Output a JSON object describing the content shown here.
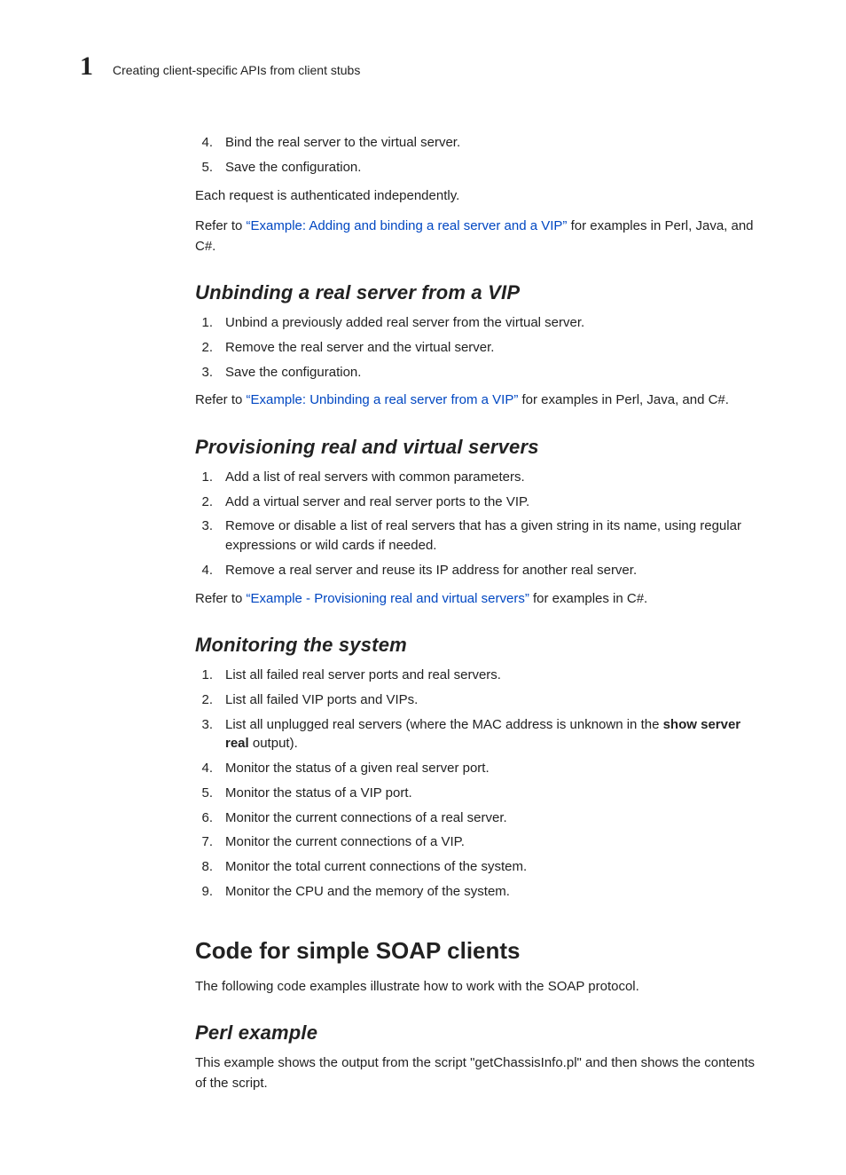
{
  "header": {
    "chapter_number": "1",
    "title": "Creating client-specific APIs from client stubs"
  },
  "intro_list": [
    {
      "n": "4.",
      "t": "Bind the real server to the virtual server."
    },
    {
      "n": "5.",
      "t": "Save the configuration."
    }
  ],
  "intro_para": "Each request is authenticated independently.",
  "intro_refer_pre": "Refer to ",
  "intro_refer_link": "“Example: Adding and binding a real server and a VIP”",
  "intro_refer_post": " for examples in Perl, Java, and C#.",
  "unbind": {
    "heading": "Unbinding a real server from a VIP",
    "items": [
      {
        "n": "1.",
        "t": "Unbind a previously added real server from the virtual server."
      },
      {
        "n": "2.",
        "t": "Remove the real server and the virtual server."
      },
      {
        "n": "3.",
        "t": "Save the configuration."
      }
    ],
    "refer_pre": "Refer to ",
    "refer_link": "“Example: Unbinding a real server from a VIP”",
    "refer_post": " for examples in Perl, Java, and C#."
  },
  "provision": {
    "heading": "Provisioning real and virtual servers",
    "items": [
      {
        "n": "1.",
        "t": "Add a list of real servers with common parameters."
      },
      {
        "n": "2.",
        "t": "Add a virtual server and real server ports to the VIP."
      },
      {
        "n": "3.",
        "t": "Remove or disable a list of real servers that has a given string in its name, using regular expressions or wild cards if needed."
      },
      {
        "n": "4.",
        "t": "Remove a real server and reuse its IP address for another real server."
      }
    ],
    "refer_pre": "Refer to ",
    "refer_link": "“Example - Provisioning real and virtual servers”",
    "refer_post": " for examples in C#."
  },
  "monitor": {
    "heading": "Monitoring the system",
    "items": [
      {
        "n": "1.",
        "t": "List all failed real server ports and real servers."
      },
      {
        "n": "2.",
        "t": "List all failed VIP ports and VIPs."
      },
      {
        "n": "3.",
        "pre": "List all unplugged real servers (where the MAC address is unknown in the ",
        "bold": "show server real",
        "post": " output)."
      },
      {
        "n": "4.",
        "t": "Monitor the status of a given real server port."
      },
      {
        "n": "5.",
        "t": "Monitor the status of a VIP port."
      },
      {
        "n": "6.",
        "t": "Monitor the current connections of a real server."
      },
      {
        "n": "7.",
        "t": "Monitor the current connections of a VIP."
      },
      {
        "n": "8.",
        "t": "Monitor the total current connections of the system."
      },
      {
        "n": "9.",
        "t": "Monitor the CPU and the memory of the system."
      }
    ]
  },
  "soap": {
    "heading": "Code for simple SOAP clients",
    "intro": "The following code examples illustrate how to work with the SOAP protocol."
  },
  "perl": {
    "heading": "Perl example",
    "body": "This example shows the output from the script \"getChassisInfo.pl\" and then shows the contents of the script."
  }
}
